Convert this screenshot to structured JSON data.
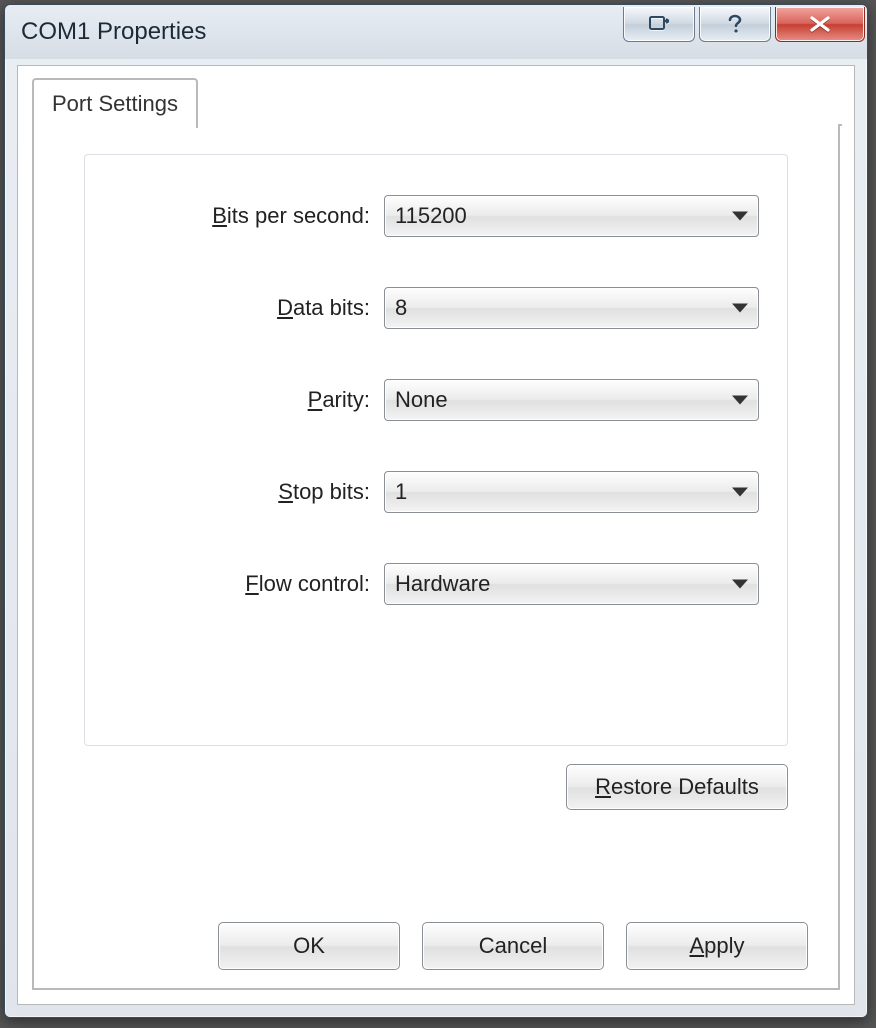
{
  "window": {
    "title": "COM1 Properties"
  },
  "tabs": {
    "port_settings": "Port Settings"
  },
  "labels": {
    "bits_per_second_pre": "B",
    "bits_per_second_post": "its per second:",
    "data_bits_pre": "D",
    "data_bits_post": "ata bits:",
    "parity_pre": "P",
    "parity_post": "arity:",
    "stop_bits_pre": "S",
    "stop_bits_post": "top bits:",
    "flow_control_pre": "F",
    "flow_control_post": "low control:"
  },
  "values": {
    "bits_per_second": "115200",
    "data_bits": "8",
    "parity": "None",
    "stop_bits": "1",
    "flow_control": "Hardware"
  },
  "buttons": {
    "restore_defaults_pre": "R",
    "restore_defaults_post": "estore Defaults",
    "ok": "OK",
    "cancel": "Cancel",
    "apply_pre": "A",
    "apply_post": "pply"
  }
}
